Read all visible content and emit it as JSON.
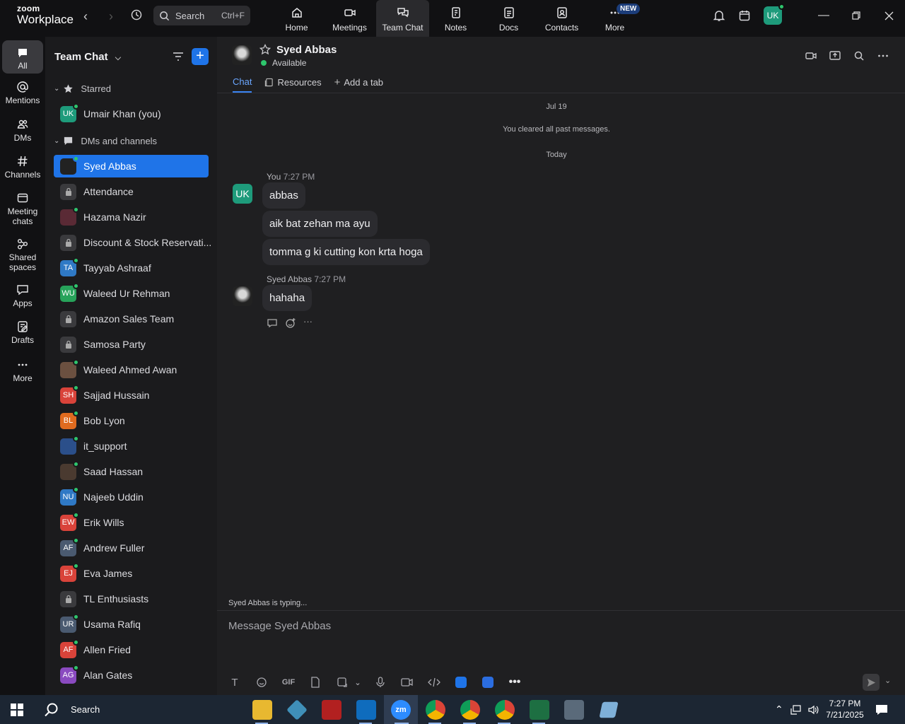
{
  "app": {
    "logo_line1": "zoom",
    "logo_line2": "Workplace"
  },
  "search": {
    "label": "Search",
    "shortcut": "Ctrl+F"
  },
  "top_tabs": [
    {
      "label": "Home"
    },
    {
      "label": "Meetings"
    },
    {
      "label": "Team Chat"
    },
    {
      "label": "Notes"
    },
    {
      "label": "Docs"
    },
    {
      "label": "Contacts"
    },
    {
      "label": "More"
    }
  ],
  "new_badge": "NEW",
  "user_initials": "UK",
  "rail": [
    {
      "label": "All"
    },
    {
      "label": "Mentions"
    },
    {
      "label": "DMs"
    },
    {
      "label": "Channels"
    },
    {
      "label": "Meeting chats"
    },
    {
      "label": "Shared spaces"
    },
    {
      "label": "Apps"
    },
    {
      "label": "Drafts"
    },
    {
      "label": "More"
    }
  ],
  "sidebar": {
    "title": "Team Chat",
    "starred_label": "Starred",
    "starred": [
      {
        "name": "Umair Khan (you)",
        "initials": "UK",
        "color": "#1e9b7b"
      }
    ],
    "dms_label": "DMs and channels",
    "items": [
      {
        "name": "Syed Abbas",
        "initials": "",
        "color": "#222222"
      },
      {
        "name": "Attendance",
        "initials": "",
        "color": "#3a3a3d"
      },
      {
        "name": "Hazama Nazir",
        "initials": "",
        "color": "#5a2a35"
      },
      {
        "name": "Discount & Stock Reservati...",
        "initials": "",
        "color": "#3a3a3d"
      },
      {
        "name": "Tayyab Ashraaf",
        "initials": "TA",
        "color": "#2f79c5"
      },
      {
        "name": "Waleed Ur Rehman",
        "initials": "WU",
        "color": "#27a35a"
      },
      {
        "name": "Amazon Sales Team",
        "initials": "",
        "color": "#3a3a3d"
      },
      {
        "name": "Samosa Party",
        "initials": "",
        "color": "#3a3a3d"
      },
      {
        "name": "Waleed Ahmed Awan",
        "initials": "",
        "color": "#6b5040"
      },
      {
        "name": "Sajjad Hussain",
        "initials": "SH",
        "color": "#d9433a"
      },
      {
        "name": "Bob Lyon",
        "initials": "BL",
        "color": "#e06b1f"
      },
      {
        "name": "it_support",
        "initials": "",
        "color": "#2b4f8a"
      },
      {
        "name": "Saad Hassan",
        "initials": "",
        "color": "#4a3a30"
      },
      {
        "name": "Najeeb Uddin",
        "initials": "NU",
        "color": "#2f79c5"
      },
      {
        "name": "Erik Wills",
        "initials": "EW",
        "color": "#d9433a"
      },
      {
        "name": "Andrew Fuller",
        "initials": "AF",
        "color": "#4a5a70"
      },
      {
        "name": "Eva James",
        "initials": "EJ",
        "color": "#d9433a"
      },
      {
        "name": "TL Enthusiasts",
        "initials": "",
        "color": "#3a3a3d"
      },
      {
        "name": "Usama Rafiq",
        "initials": "UR",
        "color": "#4a5a70"
      },
      {
        "name": "Allen Fried",
        "initials": "AF",
        "color": "#d9433a"
      },
      {
        "name": "Alan Gates",
        "initials": "AG",
        "color": "#8a4ac0"
      }
    ]
  },
  "channel": {
    "name": "Syed Abbas",
    "status": "Available",
    "tabs": [
      {
        "label": "Chat"
      },
      {
        "label": "Resources"
      },
      {
        "label": "Add a tab"
      }
    ]
  },
  "messages": {
    "date1": "Jul 19",
    "cleared": "You cleared all past messages.",
    "date2": "Today",
    "me_sender": "You",
    "me_time": "7:27 PM",
    "me_initials": "UK",
    "me_msgs": [
      "abbas",
      "aik bat zehan ma ayu",
      "tomma g ki cutting kon krta hoga"
    ],
    "them_sender": "Syed Abbas",
    "them_time": "7:27 PM",
    "them_msgs": [
      "hahaha"
    ]
  },
  "typing": "Syed Abbas  is typing...",
  "composer": {
    "placeholder": "Message Syed Abbas",
    "gif": "GIF"
  },
  "taskbar": {
    "search": "Search",
    "time": "7:27 PM",
    "date": "7/21/2025"
  }
}
